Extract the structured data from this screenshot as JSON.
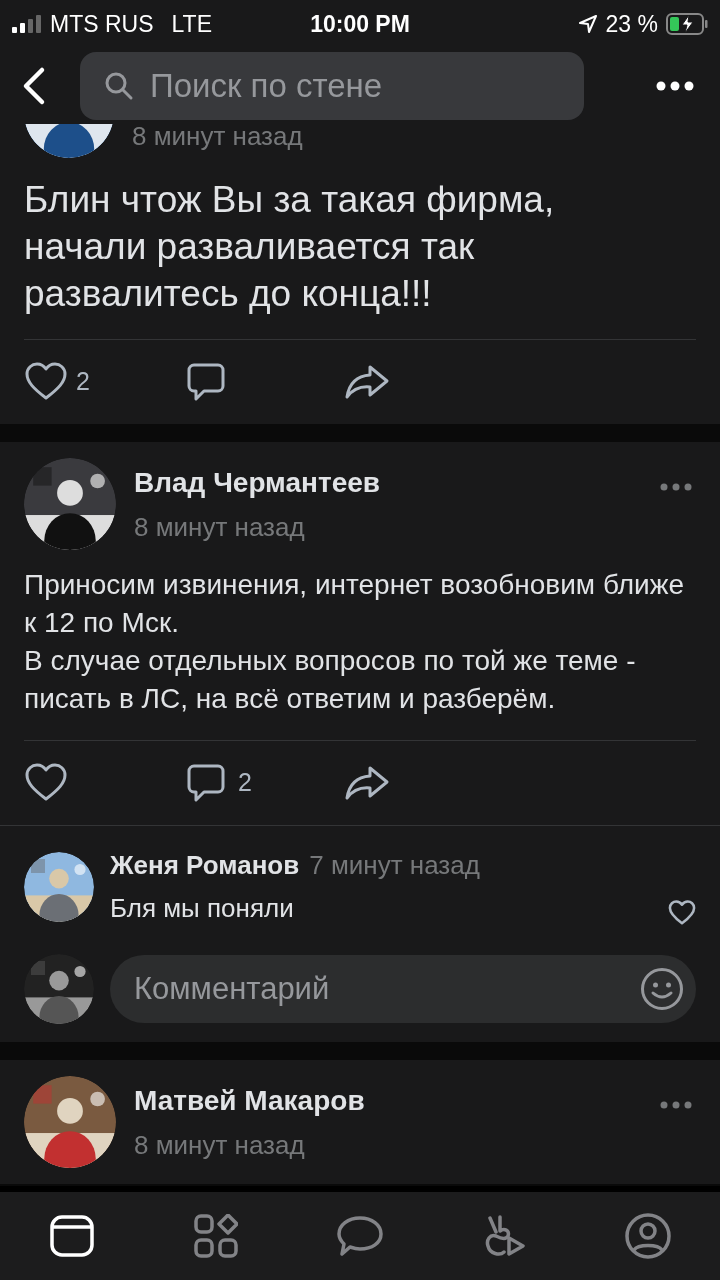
{
  "status_bar": {
    "carrier": "MTS RUS",
    "network": "LTE",
    "time": "10:00 PM",
    "battery_percent": "23 %",
    "charging": true
  },
  "header": {
    "search": {
      "placeholder": "Поиск по стене"
    }
  },
  "posts": [
    {
      "kind": "partial",
      "time": "8 минут назад",
      "text": "Блин чтож Вы за такая фирма, начали разваливается так развалитесь до конца!!!",
      "likes": "2"
    },
    {
      "kind": "full",
      "author": "Влад Чермантеев",
      "time": "8 минут назад",
      "text": "Приносим извинения, интернет возобновим ближе к 12 по Мск.\nВ случае отдельных вопросов по той же теме - писать в ЛС, на всё ответим и разберём.",
      "comments": "2",
      "comment_list": [
        {
          "author": "Женя Романов",
          "time": "7 минут назад",
          "text": "Бля мы поняли"
        }
      ],
      "comment_input": {
        "placeholder": "Комментарий"
      }
    },
    {
      "kind": "header_only",
      "author": "Матвей Макаров",
      "time": "8 минут назад"
    }
  ],
  "tab_bar": [
    {
      "kind": "feed",
      "selected": true
    },
    {
      "kind": "services",
      "selected": false
    },
    {
      "kind": "messages",
      "selected": false
    },
    {
      "kind": "clips",
      "selected": false
    },
    {
      "kind": "profile",
      "selected": false
    }
  ]
}
